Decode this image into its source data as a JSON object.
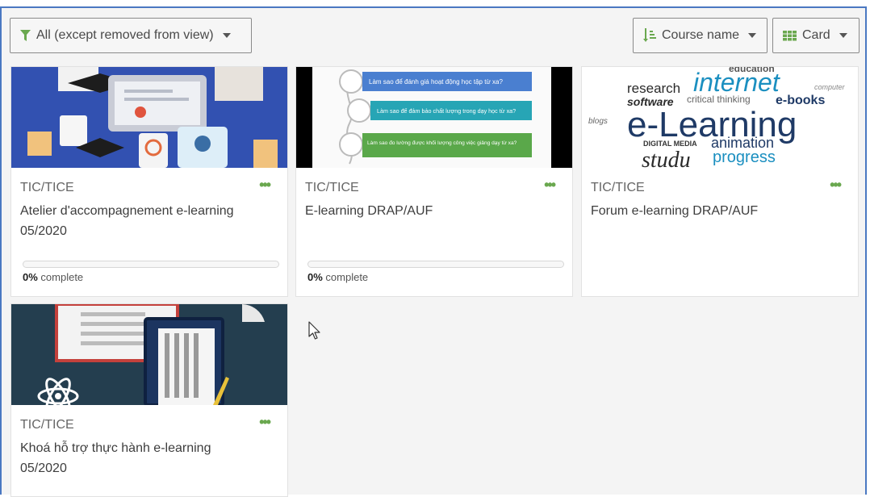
{
  "filter": {
    "label": "All (except removed from view)",
    "icon": "filter-icon"
  },
  "sort": {
    "label": "Course name",
    "icon": "sort-icon"
  },
  "view": {
    "label": "Card",
    "icon": "grid-icon"
  },
  "colors": {
    "accent": "#6aa84f",
    "frame_border": "#4a78c2"
  },
  "courses": [
    {
      "category": "TIC/TICE",
      "title": "Atelier d'accompagnement e-learning 05/2020",
      "progress_percent": 0,
      "progress_value": "0%",
      "progress_suffix": " complete",
      "image": "course-image-elearning-desk"
    },
    {
      "category": "TIC/TICE",
      "title": "E-learning DRAP/AUF",
      "progress_percent": 0,
      "progress_value": "0%",
      "progress_suffix": " complete",
      "image": "course-image-slides",
      "image_text": [
        "Làm sao để đánh giá hoạt động học tập từ xa?",
        "Làm sao để đảm bảo chất lượng trong dạy học từ xa?",
        "Làm sao đo lường được khối lượng công việc giảng dạy từ xa?"
      ]
    },
    {
      "category": "TIC/TICE",
      "title": "Forum e-learning DRAP/AUF",
      "image": "course-image-word-cloud",
      "image_text": [
        "internet",
        "e-Learning",
        "e-books",
        "research",
        "software",
        "progress",
        "animation",
        "studu",
        "education",
        "critical thinking",
        "DIGITAL MEDIA",
        "blogs",
        "computer"
      ]
    },
    {
      "category": "TIC/TICE",
      "title": "Khoá hỗ trợ thực hành e-learning 05/2020",
      "image": "course-image-books"
    }
  ]
}
